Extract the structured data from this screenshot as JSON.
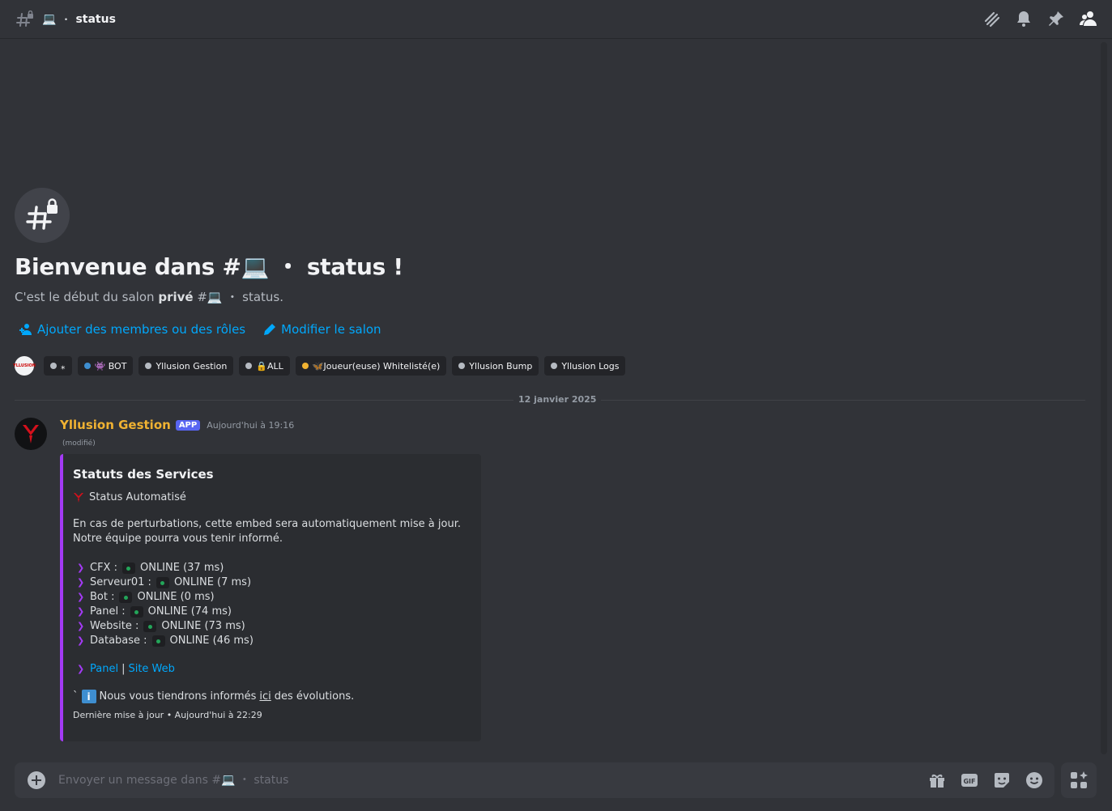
{
  "topbar": {
    "emoji": "💻",
    "separator": "・",
    "channel_name": "status"
  },
  "welcome": {
    "title": "Bienvenue dans #💻 ・ status !",
    "subtitle_prefix": "C'est le début du salon",
    "subtitle_bold": "privé",
    "subtitle_channel": "#💻 ・ status."
  },
  "actions": {
    "add_members": "Ajouter des membres ou des rôles",
    "edit_channel": "Modifier le salon"
  },
  "roles": [
    {
      "label": "⁎",
      "color": "#b5bac1"
    },
    {
      "label": "👾 BOT",
      "color": "#3e8ed0"
    },
    {
      "label": "Yllusion Gestion",
      "color": "#b5bac1"
    },
    {
      "label": "🔒ALL",
      "color": "#b5bac1"
    },
    {
      "label": "🦋Joueur(euse) Whitelisté(e)",
      "color": "#f0b232"
    },
    {
      "label": "Yllusion Bump",
      "color": "#b5bac1"
    },
    {
      "label": "Yllusion Logs",
      "color": "#b5bac1"
    }
  ],
  "role_avatar_text": "YLLUSION",
  "divider_date": "12 janvier 2025",
  "message": {
    "author": "Yllusion Gestion",
    "badge": "APP",
    "timestamp": "Aujourd'hui à 19:16",
    "edited": "(modifié)",
    "author_color": "#f0b232"
  },
  "embed": {
    "accent": "#a33af5",
    "title": "Statuts des Services",
    "author": "Status Automatisé",
    "description": "En cas de perturbations, cette embed sera automatiquement mise à jour. Notre équipe pourra vous tenir informé.",
    "services": [
      {
        "name": "CFX :",
        "status": "ONLINE (37 ms)"
      },
      {
        "name": "Serveur01 :",
        "status": "ONLINE (7 ms)"
      },
      {
        "name": "Bot :",
        "status": "ONLINE (0 ms)"
      },
      {
        "name": "Panel :",
        "status": "ONLINE (74 ms)"
      },
      {
        "name": "Website :",
        "status": "ONLINE (73 ms)"
      },
      {
        "name": "Database :",
        "status": "ONLINE (46 ms)"
      }
    ],
    "link_panel": "Panel",
    "link_sep": "|",
    "link_site": "Site Web",
    "info_tick": "`",
    "info_icon": "i",
    "info_prefix": "Nous vous tiendrons informés",
    "info_link": "ici",
    "info_suffix": "des évolutions.",
    "footer": "Dernière mise à jour • Aujourd'hui à 22:29"
  },
  "composer": {
    "placeholder": "Envoyer un message dans #💻 ・ status"
  }
}
